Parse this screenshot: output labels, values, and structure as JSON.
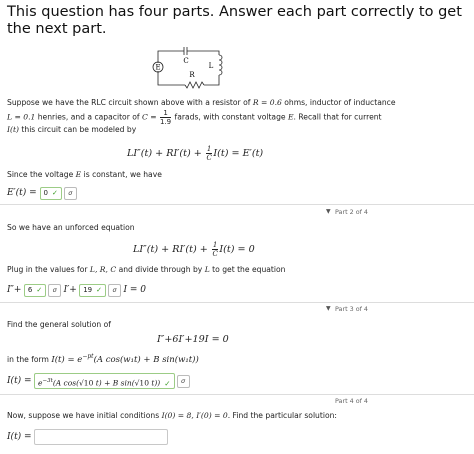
{
  "title": "This question has four parts. Answer each part correctly to get the next part.",
  "circuit": {
    "source_label": "E",
    "capacitor_label": "C",
    "inductor_label": "L",
    "resistor_label": "R"
  },
  "intro": {
    "line1_a": "Suppose we have the RLC circuit shown above with a resistor of ",
    "line1_R": "R = 0.6",
    "line1_b": " ohms, inductor of inductance",
    "line2_L": "L = 0.1",
    "line2_a": " henries, and a capacitor of ",
    "line2_C": "C =",
    "c_num": "1",
    "c_den": "1.9",
    "line2_b": " farads, with constant voltage ",
    "line2_E": "E",
    "line2_c": ". Recall that for current",
    "line3_I": "I(t)",
    "line3_a": " this circuit can be modeled by"
  },
  "eq1": {
    "lhs": "LI″(t) + RI′(t) + ",
    "num": "1",
    "den": "C",
    "rhs": "I(t) = E′(t)"
  },
  "part1": {
    "text_a": "Since the voltage ",
    "text_E": "E",
    "text_b": " is constant, we have",
    "lhs": "E′(t) = ",
    "answer": "0",
    "check": "✓",
    "key": "σ"
  },
  "part2": {
    "label": "Part 2 of 4",
    "text": "So we have an unforced equation",
    "eq_lhs": "LI″(t) + RI′(t) + ",
    "eq_num": "1",
    "eq_den": "C",
    "eq_rhs": "I(t) = 0",
    "plug_a": "Plug in the values for ",
    "plug_vars": "L, R, C",
    "plug_b": " and divide through by ",
    "plug_L": "L",
    "plug_c": " to get the equation",
    "i2": "I″+",
    "ans1": "6",
    "i1": "I′+",
    "ans2": "19",
    "i0": "I = 0",
    "check": "✓",
    "key": "σ"
  },
  "part3": {
    "label": "Part 3 of 4",
    "text": "Find the general solution of",
    "eq": "I″+6I′+19I = 0",
    "form_a": "in the form ",
    "form_eq": "I(t) = e",
    "form_exp": "−pt",
    "form_rest": "(A cos(w₁t) + B sin(w₁t))",
    "lhs": "I(t) =",
    "ans_e": "e",
    "ans_exp": "−3t",
    "ans_a": "(A cos(",
    "ans_r1": "√10",
    "ans_b": " t) + B sin(",
    "ans_r2": "√10",
    "ans_c": " t))",
    "check": "✓",
    "key": "σ"
  },
  "part4": {
    "label": "Part 4 of 4",
    "text_a": "Now, suppose we have initial conditions ",
    "cond": "I(0) = 8, I′(0) = 0",
    "text_b": ". Find the particular solution:",
    "lhs": "I(t) ="
  }
}
